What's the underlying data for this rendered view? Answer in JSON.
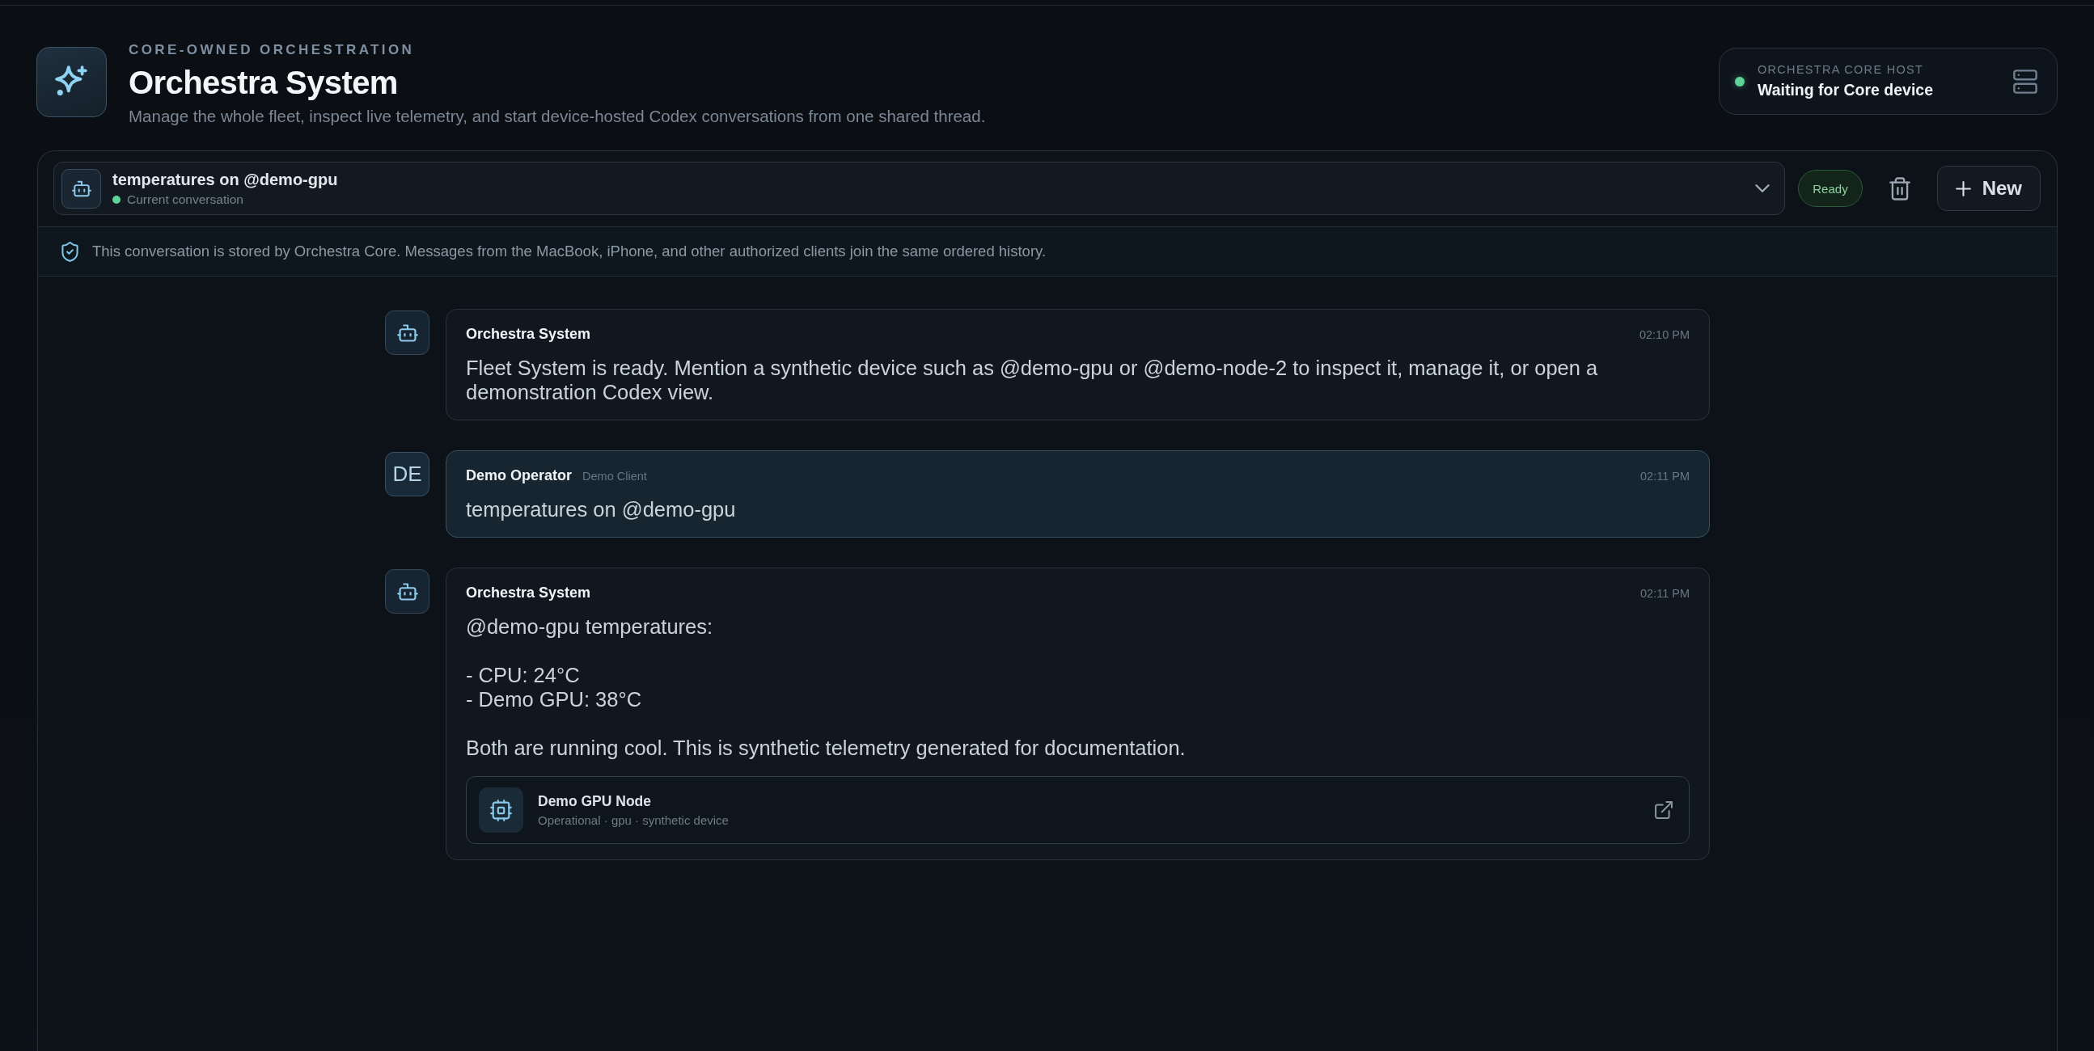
{
  "header": {
    "eyebrow": "CORE-OWNED ORCHESTRATION",
    "title": "Orchestra System",
    "subtitle": "Manage the whole fleet, inspect live telemetry, and start device-hosted Codex conversations from one shared thread."
  },
  "core_host": {
    "label": "ORCHESTRA CORE HOST",
    "status": "Waiting for Core device"
  },
  "conversation": {
    "title": "temperatures on @demo-gpu",
    "subtitle": "Current conversation",
    "status": "Ready",
    "new_button": "New"
  },
  "notice": "This conversation is stored by Orchestra Core. Messages from the MacBook, iPhone, and other authorized clients join the same ordered history.",
  "messages": [
    {
      "kind": "system",
      "author": "Orchestra System",
      "time": "02:10 PM",
      "body": "Fleet System is ready. Mention a synthetic device such as @demo-gpu or @demo-node-2 to inspect it, manage it, or open a demonstration Codex view."
    },
    {
      "kind": "user",
      "avatar": "DE",
      "author": "Demo Operator",
      "client": "Demo Client",
      "time": "02:11 PM",
      "body": "temperatures on @demo-gpu"
    },
    {
      "kind": "system",
      "author": "Orchestra System",
      "time": "02:11 PM",
      "body": "@demo-gpu temperatures:\n\n- CPU: 24°C\n- Demo GPU: 38°C\n\nBoth are running cool. This is synthetic telemetry generated for documentation.",
      "device": {
        "name": "Demo GPU Node",
        "details": "Operational · gpu · synthetic device"
      }
    }
  ]
}
